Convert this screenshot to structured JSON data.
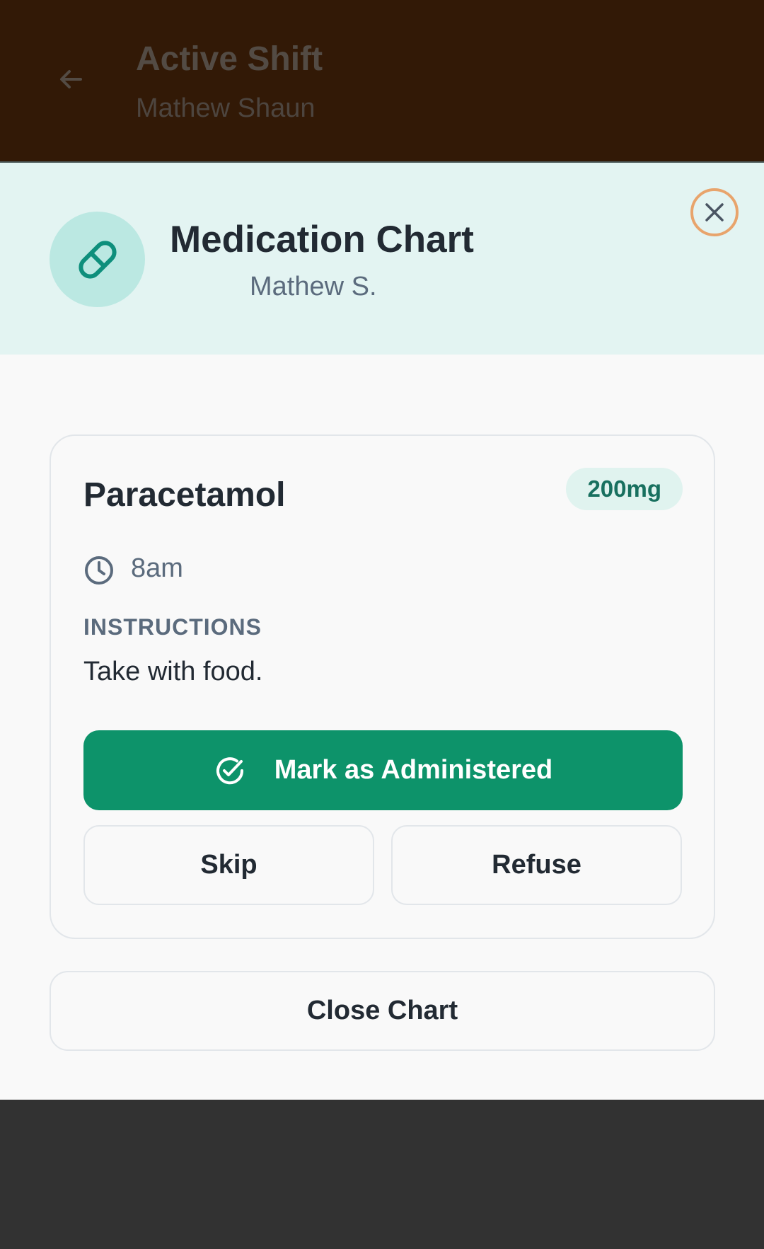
{
  "background_screen": {
    "title": "Active Shift",
    "subtitle": "Mathew Shaun"
  },
  "sheet": {
    "title": "Medication Chart",
    "subtitle": "Mathew S.",
    "icon": "pill-icon"
  },
  "medication": {
    "name": "Paracetamol",
    "dose": "200mg",
    "time": "8am",
    "instructions_heading": "INSTRUCTIONS",
    "instructions": "Take with food."
  },
  "actions": {
    "administer_label": "Mark as Administered",
    "skip_label": "Skip",
    "refuse_label": "Refuse",
    "close_chart_label": "Close Chart"
  },
  "colors": {
    "accent_green": "#0d936a",
    "close_ring": "#e8a46c",
    "header_tint": "#e3f4f2"
  }
}
